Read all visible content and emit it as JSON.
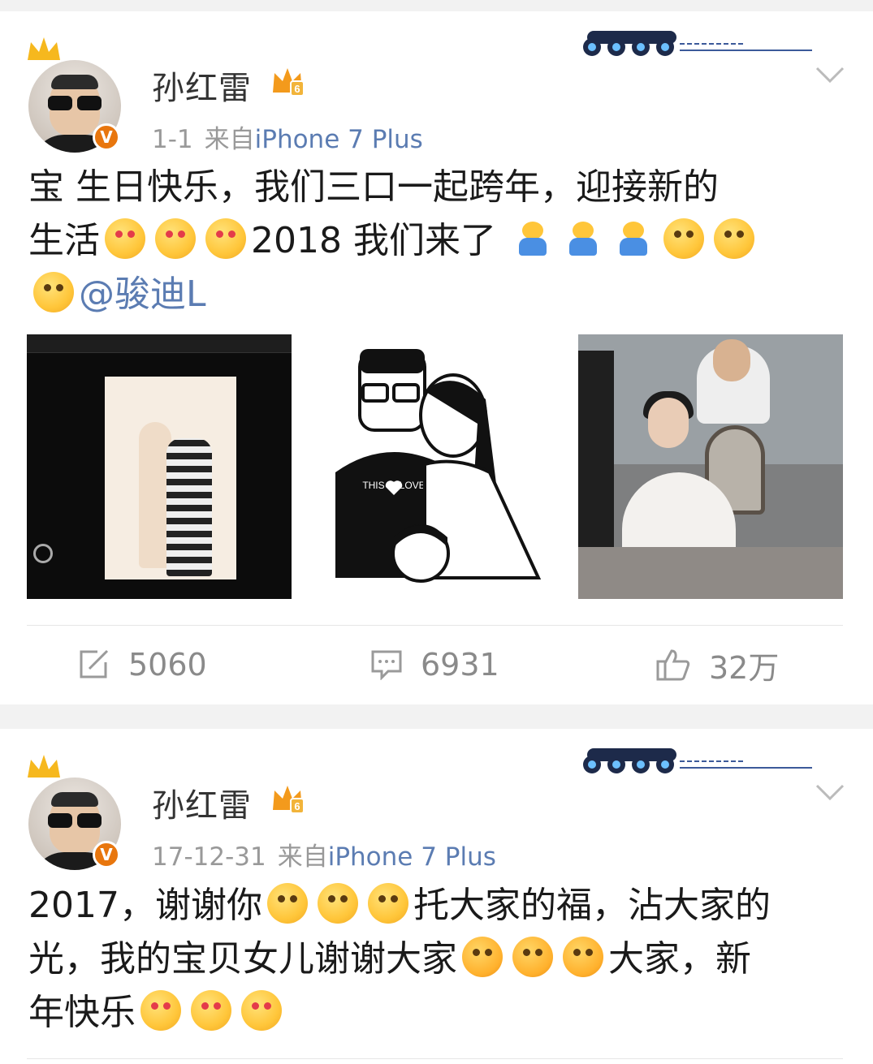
{
  "posts": [
    {
      "author": "孙红雷",
      "time": "1-1",
      "source_prefix": "来自",
      "device": "iPhone 7 Plus",
      "verified_badge": "V",
      "text": {
        "line1": "宝  生日快乐，我们三口一起跨年，迎接新的",
        "line2_a": "生活",
        "line2_b": "2018  我们来了",
        "mention": "@骏迪L"
      },
      "images": [
        "photo-studio-screen",
        "cartoon-family-drawing",
        "dressing-room-photo"
      ],
      "actions": {
        "forward_count": "5060",
        "comment_count": "6931",
        "like_count": "32万"
      }
    },
    {
      "author": "孙红雷",
      "time": "17-12-31",
      "source_prefix": "来自",
      "device": "iPhone 7 Plus",
      "verified_badge": "V",
      "text": {
        "line1_a": "2017，谢谢你",
        "line1_b": "托大家的福，沾大家的",
        "line2_a": "光，我的宝贝女儿谢谢大家",
        "line2_b": "大家，新",
        "line3": "年快乐"
      }
    }
  ],
  "icons": {
    "more": "chevron-down-icon",
    "forward": "forward-icon",
    "comment": "comment-icon",
    "like": "thumbs-up-icon"
  },
  "colors": {
    "link": "#5b7cb2",
    "verified": "#e8760e",
    "meta": "#999999"
  }
}
